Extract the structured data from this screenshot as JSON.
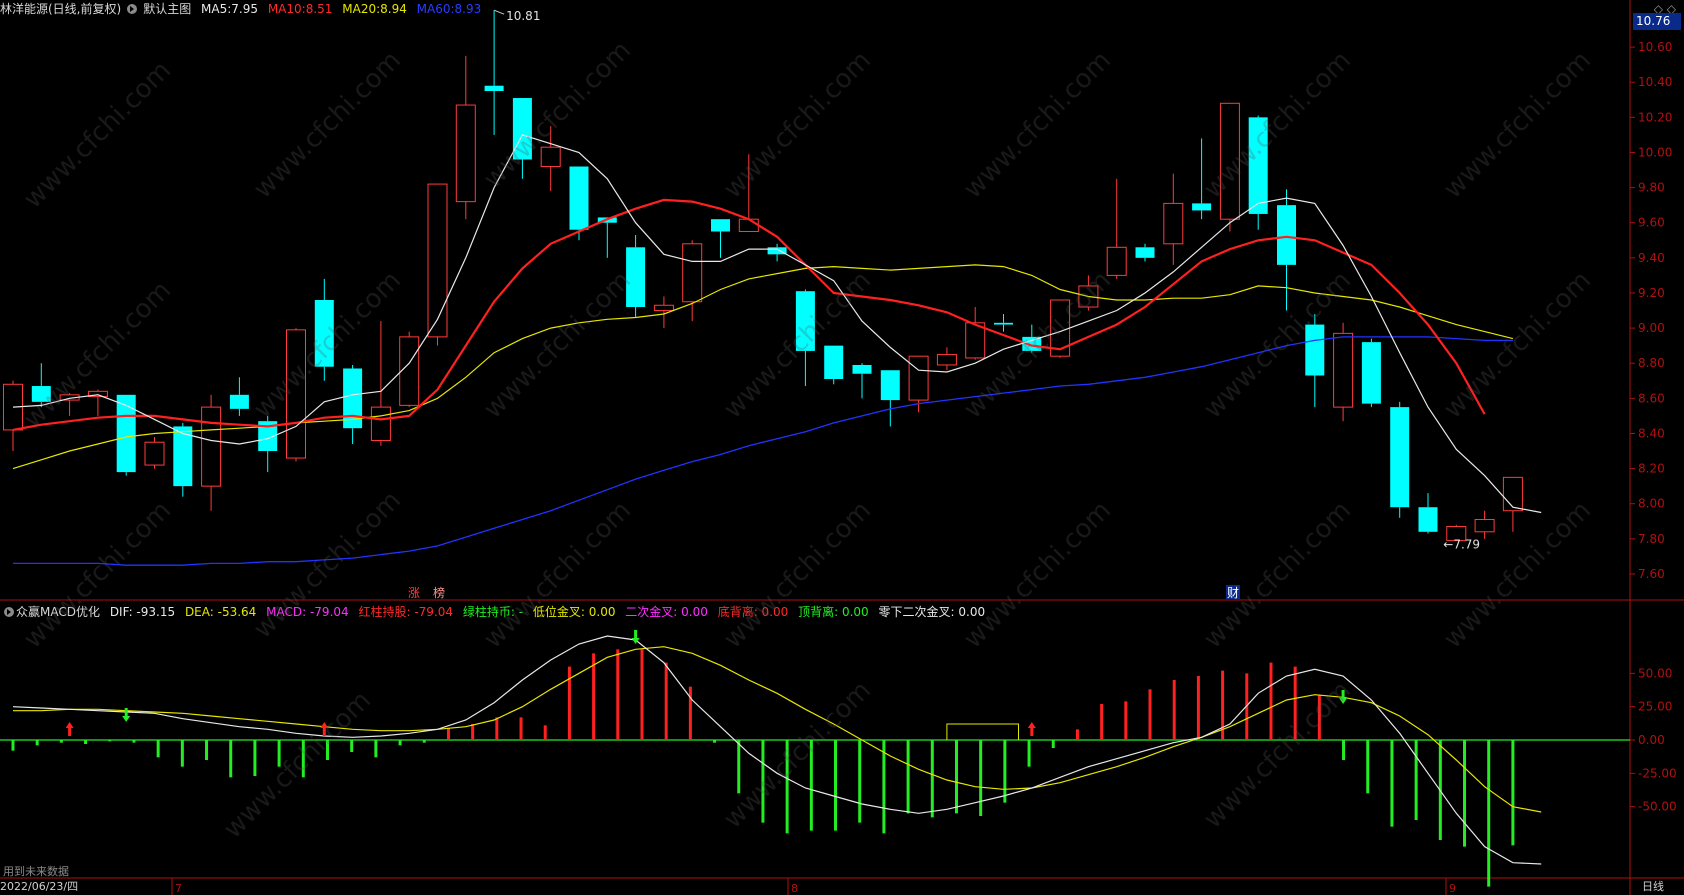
{
  "header": {
    "stock": "林洋能源(日线,前复权)",
    "template": "默认主图",
    "ma5_label": "MA5:",
    "ma5_value": "7.95",
    "ma10_label": "MA10:",
    "ma10_value": "8.51",
    "ma20_label": "MA20:",
    "ma20_value": "8.94",
    "ma60_label": "MA60:",
    "ma60_value": "8.93"
  },
  "indicator_header": {
    "name": "众赢MACD优化",
    "dif": "DIF: -93.15",
    "dea": "DEA: -53.64",
    "macd": "MACD: -79.04",
    "red_hold": "红柱持股: -79.04",
    "green_hold": "绿柱持币: -",
    "low_cross": "低位金叉: 0.00",
    "second_cross": "二次金叉: 0.00",
    "bottom_div": "底背离: 0.00",
    "top_div": "顶背离: 0.00",
    "below_zero_cross": "零下二次金叉: 0.00"
  },
  "current_price_tag": "10.76",
  "top_right_icons": "◇ ◇",
  "price_axis": [
    "10.60",
    "10.40",
    "10.20",
    "10.00",
    "9.80",
    "9.60",
    "9.40",
    "9.20",
    "9.00",
    "8.80",
    "8.60",
    "8.40",
    "8.20",
    "8.00",
    "7.80",
    "7.60"
  ],
  "macd_axis": [
    "50.00",
    "25.00",
    "0.00",
    "-25.00",
    "-50.00"
  ],
  "annotations": {
    "high": "10.81",
    "low": "←7.79"
  },
  "event_tags": [
    "涨",
    "榜",
    "财"
  ],
  "x_axis": {
    "current_date": "2022/06/23/四",
    "month_labels": [
      "7",
      "8",
      "9"
    ],
    "period": "日线"
  },
  "note": "用到未来数据",
  "watermark": "www.cfchi.com",
  "colors": {
    "up": "#ff3b3b",
    "down": "#00ffff",
    "ma5": "#e8e8e8",
    "ma10": "#ff2020",
    "ma20": "#e6e600",
    "ma60": "#2233ff",
    "axis": "#b01010",
    "macd_up": "#ff2020",
    "macd_down": "#22ee22"
  },
  "chart_data": {
    "type": "candlestick",
    "y_range": [
      7.52,
      10.76
    ],
    "candles": [
      {
        "o": 8.42,
        "c": 8.68,
        "h": 8.7,
        "l": 8.3
      },
      {
        "o": 8.67,
        "c": 8.58,
        "h": 8.8,
        "l": 8.55
      },
      {
        "o": 8.59,
        "c": 8.62,
        "h": 8.63,
        "l": 8.5
      },
      {
        "o": 8.61,
        "c": 8.64,
        "h": 8.65,
        "l": 8.5
      },
      {
        "o": 8.62,
        "c": 8.18,
        "h": 8.62,
        "l": 8.16
      },
      {
        "o": 8.22,
        "c": 8.35,
        "h": 8.38,
        "l": 8.2
      },
      {
        "o": 8.44,
        "c": 8.1,
        "h": 8.46,
        "l": 8.04
      },
      {
        "o": 8.1,
        "c": 8.55,
        "h": 8.62,
        "l": 7.96
      },
      {
        "o": 8.62,
        "c": 8.54,
        "h": 8.72,
        "l": 8.5
      },
      {
        "o": 8.47,
        "c": 8.3,
        "h": 8.5,
        "l": 8.18
      },
      {
        "o": 8.26,
        "c": 8.99,
        "h": 9.0,
        "l": 8.24
      },
      {
        "o": 9.16,
        "c": 8.78,
        "h": 9.28,
        "l": 8.7
      },
      {
        "o": 8.77,
        "c": 8.43,
        "h": 8.79,
        "l": 8.34
      },
      {
        "o": 8.36,
        "c": 8.55,
        "h": 9.04,
        "l": 8.33
      },
      {
        "o": 8.56,
        "c": 8.95,
        "h": 8.98,
        "l": 8.55
      },
      {
        "o": 8.95,
        "c": 9.82,
        "h": 9.82,
        "l": 8.9
      },
      {
        "o": 9.72,
        "c": 10.27,
        "h": 10.55,
        "l": 9.62
      },
      {
        "o": 10.38,
        "c": 10.35,
        "h": 10.81,
        "l": 10.1
      },
      {
        "o": 10.31,
        "c": 9.96,
        "h": 10.31,
        "l": 9.85
      },
      {
        "o": 9.92,
        "c": 10.03,
        "h": 10.15,
        "l": 9.78
      },
      {
        "o": 9.92,
        "c": 9.56,
        "h": 9.92,
        "l": 9.5
      },
      {
        "o": 9.63,
        "c": 9.6,
        "h": 9.62,
        "l": 9.4
      },
      {
        "o": 9.46,
        "c": 9.12,
        "h": 9.53,
        "l": 9.06
      },
      {
        "o": 9.1,
        "c": 9.13,
        "h": 9.18,
        "l": 9.0
      },
      {
        "o": 9.15,
        "c": 9.48,
        "h": 9.5,
        "l": 9.04
      },
      {
        "o": 9.62,
        "c": 9.55,
        "h": 9.62,
        "l": 9.4
      },
      {
        "o": 9.55,
        "c": 9.62,
        "h": 9.99,
        "l": 9.55
      },
      {
        "o": 9.46,
        "c": 9.42,
        "h": 9.48,
        "l": 9.38
      },
      {
        "o": 9.21,
        "c": 8.87,
        "h": 9.22,
        "l": 8.67
      },
      {
        "o": 8.9,
        "c": 8.71,
        "h": 8.9,
        "l": 8.68
      },
      {
        "o": 8.79,
        "c": 8.74,
        "h": 8.8,
        "l": 8.6
      },
      {
        "o": 8.76,
        "c": 8.59,
        "h": 8.76,
        "l": 8.44
      },
      {
        "o": 8.59,
        "c": 8.84,
        "h": 8.84,
        "l": 8.52
      },
      {
        "o": 8.79,
        "c": 8.85,
        "h": 8.89,
        "l": 8.76
      },
      {
        "o": 8.83,
        "c": 9.03,
        "h": 9.12,
        "l": 8.82
      },
      {
        "o": 9.03,
        "c": 9.02,
        "h": 9.08,
        "l": 8.98
      },
      {
        "o": 8.95,
        "c": 8.87,
        "h": 9.02,
        "l": 8.86
      },
      {
        "o": 8.84,
        "c": 9.16,
        "h": 9.16,
        "l": 8.83
      },
      {
        "o": 9.12,
        "c": 9.24,
        "h": 9.3,
        "l": 9.1
      },
      {
        "o": 9.3,
        "c": 9.46,
        "h": 9.85,
        "l": 9.28
      },
      {
        "o": 9.46,
        "c": 9.4,
        "h": 9.48,
        "l": 9.38
      },
      {
        "o": 9.48,
        "c": 9.71,
        "h": 9.88,
        "l": 9.36
      },
      {
        "o": 9.71,
        "c": 9.67,
        "h": 10.08,
        "l": 9.62
      },
      {
        "o": 9.62,
        "c": 10.28,
        "h": 10.28,
        "l": 9.55
      },
      {
        "o": 10.2,
        "c": 9.65,
        "h": 10.21,
        "l": 9.56
      },
      {
        "o": 9.7,
        "c": 9.36,
        "h": 9.79,
        "l": 9.1
      },
      {
        "o": 9.02,
        "c": 8.73,
        "h": 9.08,
        "l": 8.55
      },
      {
        "o": 8.55,
        "c": 8.97,
        "h": 9.03,
        "l": 8.47
      },
      {
        "o": 8.92,
        "c": 8.57,
        "h": 8.94,
        "l": 8.55
      },
      {
        "o": 8.55,
        "c": 7.98,
        "h": 8.58,
        "l": 7.92
      },
      {
        "o": 7.98,
        "c": 7.84,
        "h": 8.06,
        "l": 7.83
      },
      {
        "o": 7.79,
        "c": 7.87,
        "h": 7.88,
        "l": 7.79
      },
      {
        "o": 7.84,
        "c": 7.91,
        "h": 7.96,
        "l": 7.8
      },
      {
        "o": 7.96,
        "c": 8.15,
        "h": 8.15,
        "l": 7.84
      }
    ],
    "ma5": [
      8.55,
      8.56,
      8.6,
      8.62,
      8.56,
      8.48,
      8.4,
      8.36,
      8.34,
      8.37,
      8.44,
      8.58,
      8.62,
      8.64,
      8.8,
      9.05,
      9.4,
      9.8,
      10.1,
      10.05,
      10.0,
      9.85,
      9.6,
      9.42,
      9.38,
      9.38,
      9.45,
      9.45,
      9.36,
      9.27,
      9.04,
      8.89,
      8.76,
      8.75,
      8.8,
      8.88,
      8.93,
      8.98,
      9.04,
      9.1,
      9.2,
      9.32,
      9.46,
      9.6,
      9.71,
      9.74,
      9.71,
      9.47,
      9.18,
      8.86,
      8.55,
      8.31,
      8.16,
      7.98,
      7.95
    ],
    "ma10": [
      8.42,
      8.45,
      8.47,
      8.49,
      8.5,
      8.5,
      8.48,
      8.46,
      8.45,
      8.44,
      8.46,
      8.49,
      8.5,
      8.48,
      8.5,
      8.65,
      8.9,
      9.15,
      9.34,
      9.48,
      9.55,
      9.62,
      9.68,
      9.73,
      9.72,
      9.68,
      9.62,
      9.52,
      9.36,
      9.2,
      9.18,
      9.16,
      9.13,
      9.09,
      9.02,
      8.96,
      8.9,
      8.88,
      8.95,
      9.02,
      9.12,
      9.25,
      9.38,
      9.45,
      9.5,
      9.52,
      9.5,
      9.43,
      9.36,
      9.2,
      9.02,
      8.8,
      8.51
    ],
    "ma20": [
      8.2,
      8.25,
      8.3,
      8.34,
      8.38,
      8.4,
      8.41,
      8.42,
      8.43,
      8.44,
      8.46,
      8.47,
      8.48,
      8.5,
      8.53,
      8.6,
      8.72,
      8.86,
      8.94,
      9.0,
      9.03,
      9.05,
      9.06,
      9.08,
      9.14,
      9.22,
      9.28,
      9.31,
      9.34,
      9.35,
      9.34,
      9.33,
      9.34,
      9.35,
      9.36,
      9.35,
      9.3,
      9.22,
      9.18,
      9.16,
      9.16,
      9.17,
      9.17,
      9.19,
      9.24,
      9.23,
      9.2,
      9.18,
      9.16,
      9.12,
      9.07,
      9.02,
      8.98,
      8.94
    ],
    "ma60": [
      7.66,
      7.66,
      7.66,
      7.66,
      7.65,
      7.65,
      7.65,
      7.66,
      7.66,
      7.67,
      7.67,
      7.68,
      7.69,
      7.71,
      7.73,
      7.76,
      7.81,
      7.86,
      7.91,
      7.96,
      8.02,
      8.08,
      8.14,
      8.19,
      8.24,
      8.28,
      8.33,
      8.37,
      8.41,
      8.46,
      8.5,
      8.54,
      8.57,
      8.59,
      8.61,
      8.63,
      8.65,
      8.67,
      8.68,
      8.7,
      8.72,
      8.75,
      8.78,
      8.82,
      8.86,
      8.9,
      8.93,
      8.95,
      8.95,
      8.95,
      8.95,
      8.94,
      8.93,
      8.93
    ],
    "macd": {
      "y_range": [
        -115,
        80
      ],
      "hist": [
        -8,
        -4,
        -2,
        -3,
        -1,
        -2,
        -13,
        -20,
        -15,
        -28,
        -27,
        -20,
        -28,
        -15,
        -9,
        -13,
        -4,
        -2,
        9,
        12,
        17,
        17,
        11,
        55,
        65,
        68,
        68,
        58,
        40,
        -2,
        -40,
        -62,
        -70,
        -68,
        -68,
        -62,
        -70,
        -55,
        -58,
        -55,
        -57,
        -47,
        -20,
        -6,
        8,
        27,
        29,
        38,
        45,
        48,
        52,
        50,
        58,
        55,
        34,
        -15,
        -40,
        -65,
        -60,
        -75,
        -80,
        -110,
        -79
      ],
      "dif": [
        25,
        24,
        23,
        22,
        21,
        20,
        16,
        13,
        10,
        8,
        5,
        3,
        2,
        3,
        5,
        8,
        15,
        28,
        45,
        60,
        72,
        78,
        75,
        58,
        30,
        10,
        -10,
        -25,
        -36,
        -42,
        -48,
        -52,
        -55,
        -52,
        -47,
        -42,
        -36,
        -28,
        -20,
        -14,
        -8,
        -2,
        2,
        12,
        35,
        48,
        53,
        48,
        30,
        5,
        -25,
        -55,
        -80,
        -92,
        -93
      ],
      "dea": [
        22,
        22,
        23,
        23,
        22,
        21,
        20,
        18,
        16,
        14,
        12,
        10,
        8,
        7,
        7,
        8,
        10,
        15,
        25,
        38,
        50,
        62,
        68,
        70,
        65,
        56,
        45,
        35,
        23,
        12,
        0,
        -12,
        -22,
        -30,
        -35,
        -37,
        -36,
        -32,
        -26,
        -20,
        -13,
        -5,
        2,
        10,
        20,
        30,
        34,
        32,
        28,
        18,
        4,
        -15,
        -35,
        -50,
        -54
      ],
      "up_arrows": [
        2,
        11,
        36
      ],
      "down_arrows": [
        4,
        22,
        47
      ]
    }
  }
}
